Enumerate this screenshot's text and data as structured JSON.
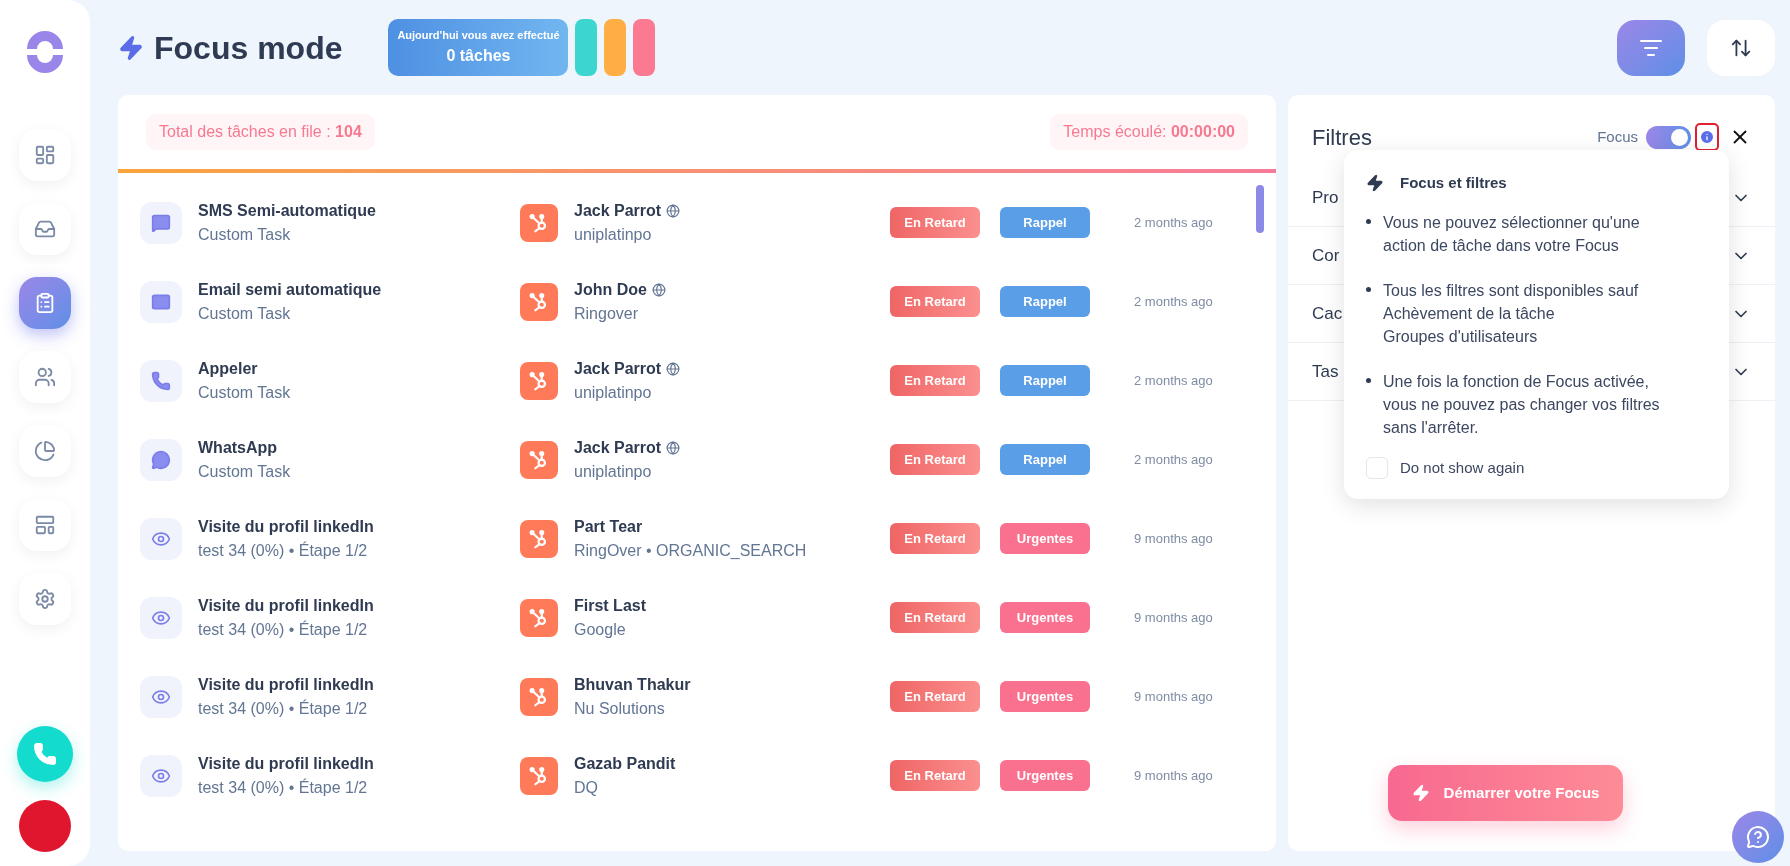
{
  "header": {
    "title": "Focus mode",
    "summary": {
      "line1": "Aujourd'hui vous avez effectué",
      "line2": "0 tâches"
    },
    "color_chips": [
      {
        "color": "#3dd6cf"
      },
      {
        "color": "#ffad45"
      },
      {
        "color": "#fb7a92"
      }
    ]
  },
  "sidebar": {
    "items": [
      {
        "kind": "dashboard",
        "selected": false
      },
      {
        "kind": "inbox",
        "selected": false
      },
      {
        "kind": "tasks",
        "selected": true
      },
      {
        "kind": "contacts",
        "selected": false
      },
      {
        "kind": "reports",
        "selected": false
      },
      {
        "kind": "templates",
        "selected": false
      },
      {
        "kind": "settings",
        "selected": false
      }
    ]
  },
  "queue": {
    "total_label": "Total des tâches en file :",
    "total": "104",
    "elapsed_label": "Temps écoulé:",
    "elapsed": "00:00:00",
    "rows": [
      {
        "kind": "sms",
        "title": "SMS Semi-automatique",
        "subtitle": "Custom Task",
        "contact": "Jack Parrot",
        "timezone_icon": true,
        "company": "uniplatinpo",
        "status": "En Retard",
        "tag": {
          "label": "Rappel",
          "color": "#5a9ee8"
        },
        "time": "2 months ago"
      },
      {
        "kind": "email",
        "title": "Email semi automatique",
        "subtitle": "Custom Task",
        "contact": "John Doe",
        "timezone_icon": true,
        "company": "Ringover",
        "status": "En Retard",
        "tag": {
          "label": "Rappel",
          "color": "#5a9ee8"
        },
        "time": "2 months ago"
      },
      {
        "kind": "call",
        "title": "Appeler",
        "subtitle": "Custom Task",
        "contact": "Jack Parrot",
        "timezone_icon": true,
        "company": "uniplatinpo",
        "status": "En Retard",
        "tag": {
          "label": "Rappel",
          "color": "#5a9ee8"
        },
        "time": "2 months ago"
      },
      {
        "kind": "whatsapp",
        "title": "WhatsApp",
        "subtitle": "Custom Task",
        "contact": "Jack Parrot",
        "timezone_icon": true,
        "company": "uniplatinpo",
        "status": "En Retard",
        "tag": {
          "label": "Rappel",
          "color": "#5a9ee8"
        },
        "time": "2 months ago"
      },
      {
        "kind": "linkedin",
        "title": "Visite du profil linkedIn",
        "subtitle": "test 34 (0%) • Étape 1/2",
        "contact": "Part Tear",
        "timezone_icon": false,
        "company": "RingOver • ORGANIC_SEARCH",
        "status": "En Retard",
        "tag": {
          "label": "Urgentes",
          "color": "#f9718f"
        },
        "time": "9 months ago"
      },
      {
        "kind": "linkedin",
        "title": "Visite du profil linkedIn",
        "subtitle": "test 34 (0%) • Étape 1/2",
        "contact": "First Last",
        "timezone_icon": false,
        "company": "Google",
        "status": "En Retard",
        "tag": {
          "label": "Urgentes",
          "color": "#f9718f"
        },
        "time": "9 months ago"
      },
      {
        "kind": "linkedin",
        "title": "Visite du profil linkedIn",
        "subtitle": "test 34 (0%) • Étape 1/2",
        "contact": "Bhuvan Thakur",
        "timezone_icon": false,
        "company": "Nu Solutions",
        "status": "En Retard",
        "tag": {
          "label": "Urgentes",
          "color": "#f9718f"
        },
        "time": "9 months ago"
      },
      {
        "kind": "linkedin",
        "title": "Visite du profil linkedIn",
        "subtitle": "test 34 (0%) • Étape 1/2",
        "contact": "Gazab Pandit",
        "timezone_icon": false,
        "company": "DQ",
        "status": "En Retard",
        "tag": {
          "label": "Urgentes",
          "color": "#f9718f"
        },
        "time": "9 months ago"
      }
    ]
  },
  "filters": {
    "title": "Filtres",
    "focus_label": "Focus",
    "focus_on": true,
    "sections": [
      {
        "label": "Pro",
        "expanded": false
      },
      {
        "label": "Cor",
        "expanded": false
      },
      {
        "label": "Cac",
        "expanded": false
      },
      {
        "label": "Tas",
        "expanded": false
      }
    ],
    "popover": {
      "title": "Focus et filtres",
      "bullets": [
        [
          "Vous ne pouvez sélectionner qu'une action de tâche dans votre Focus"
        ],
        [
          "Tous les filtres sont disponibles sauf",
          "Achèvement de la tâche",
          "Groupes d'utilisateurs"
        ],
        [
          "Une fois la fonction de Focus activée, vous ne pouvez pas changer vos filtres sans l'arrêter."
        ]
      ],
      "checkbox": {
        "label": "Do not show again",
        "checked": false
      }
    },
    "start_button": "Démarrer votre Focus"
  }
}
